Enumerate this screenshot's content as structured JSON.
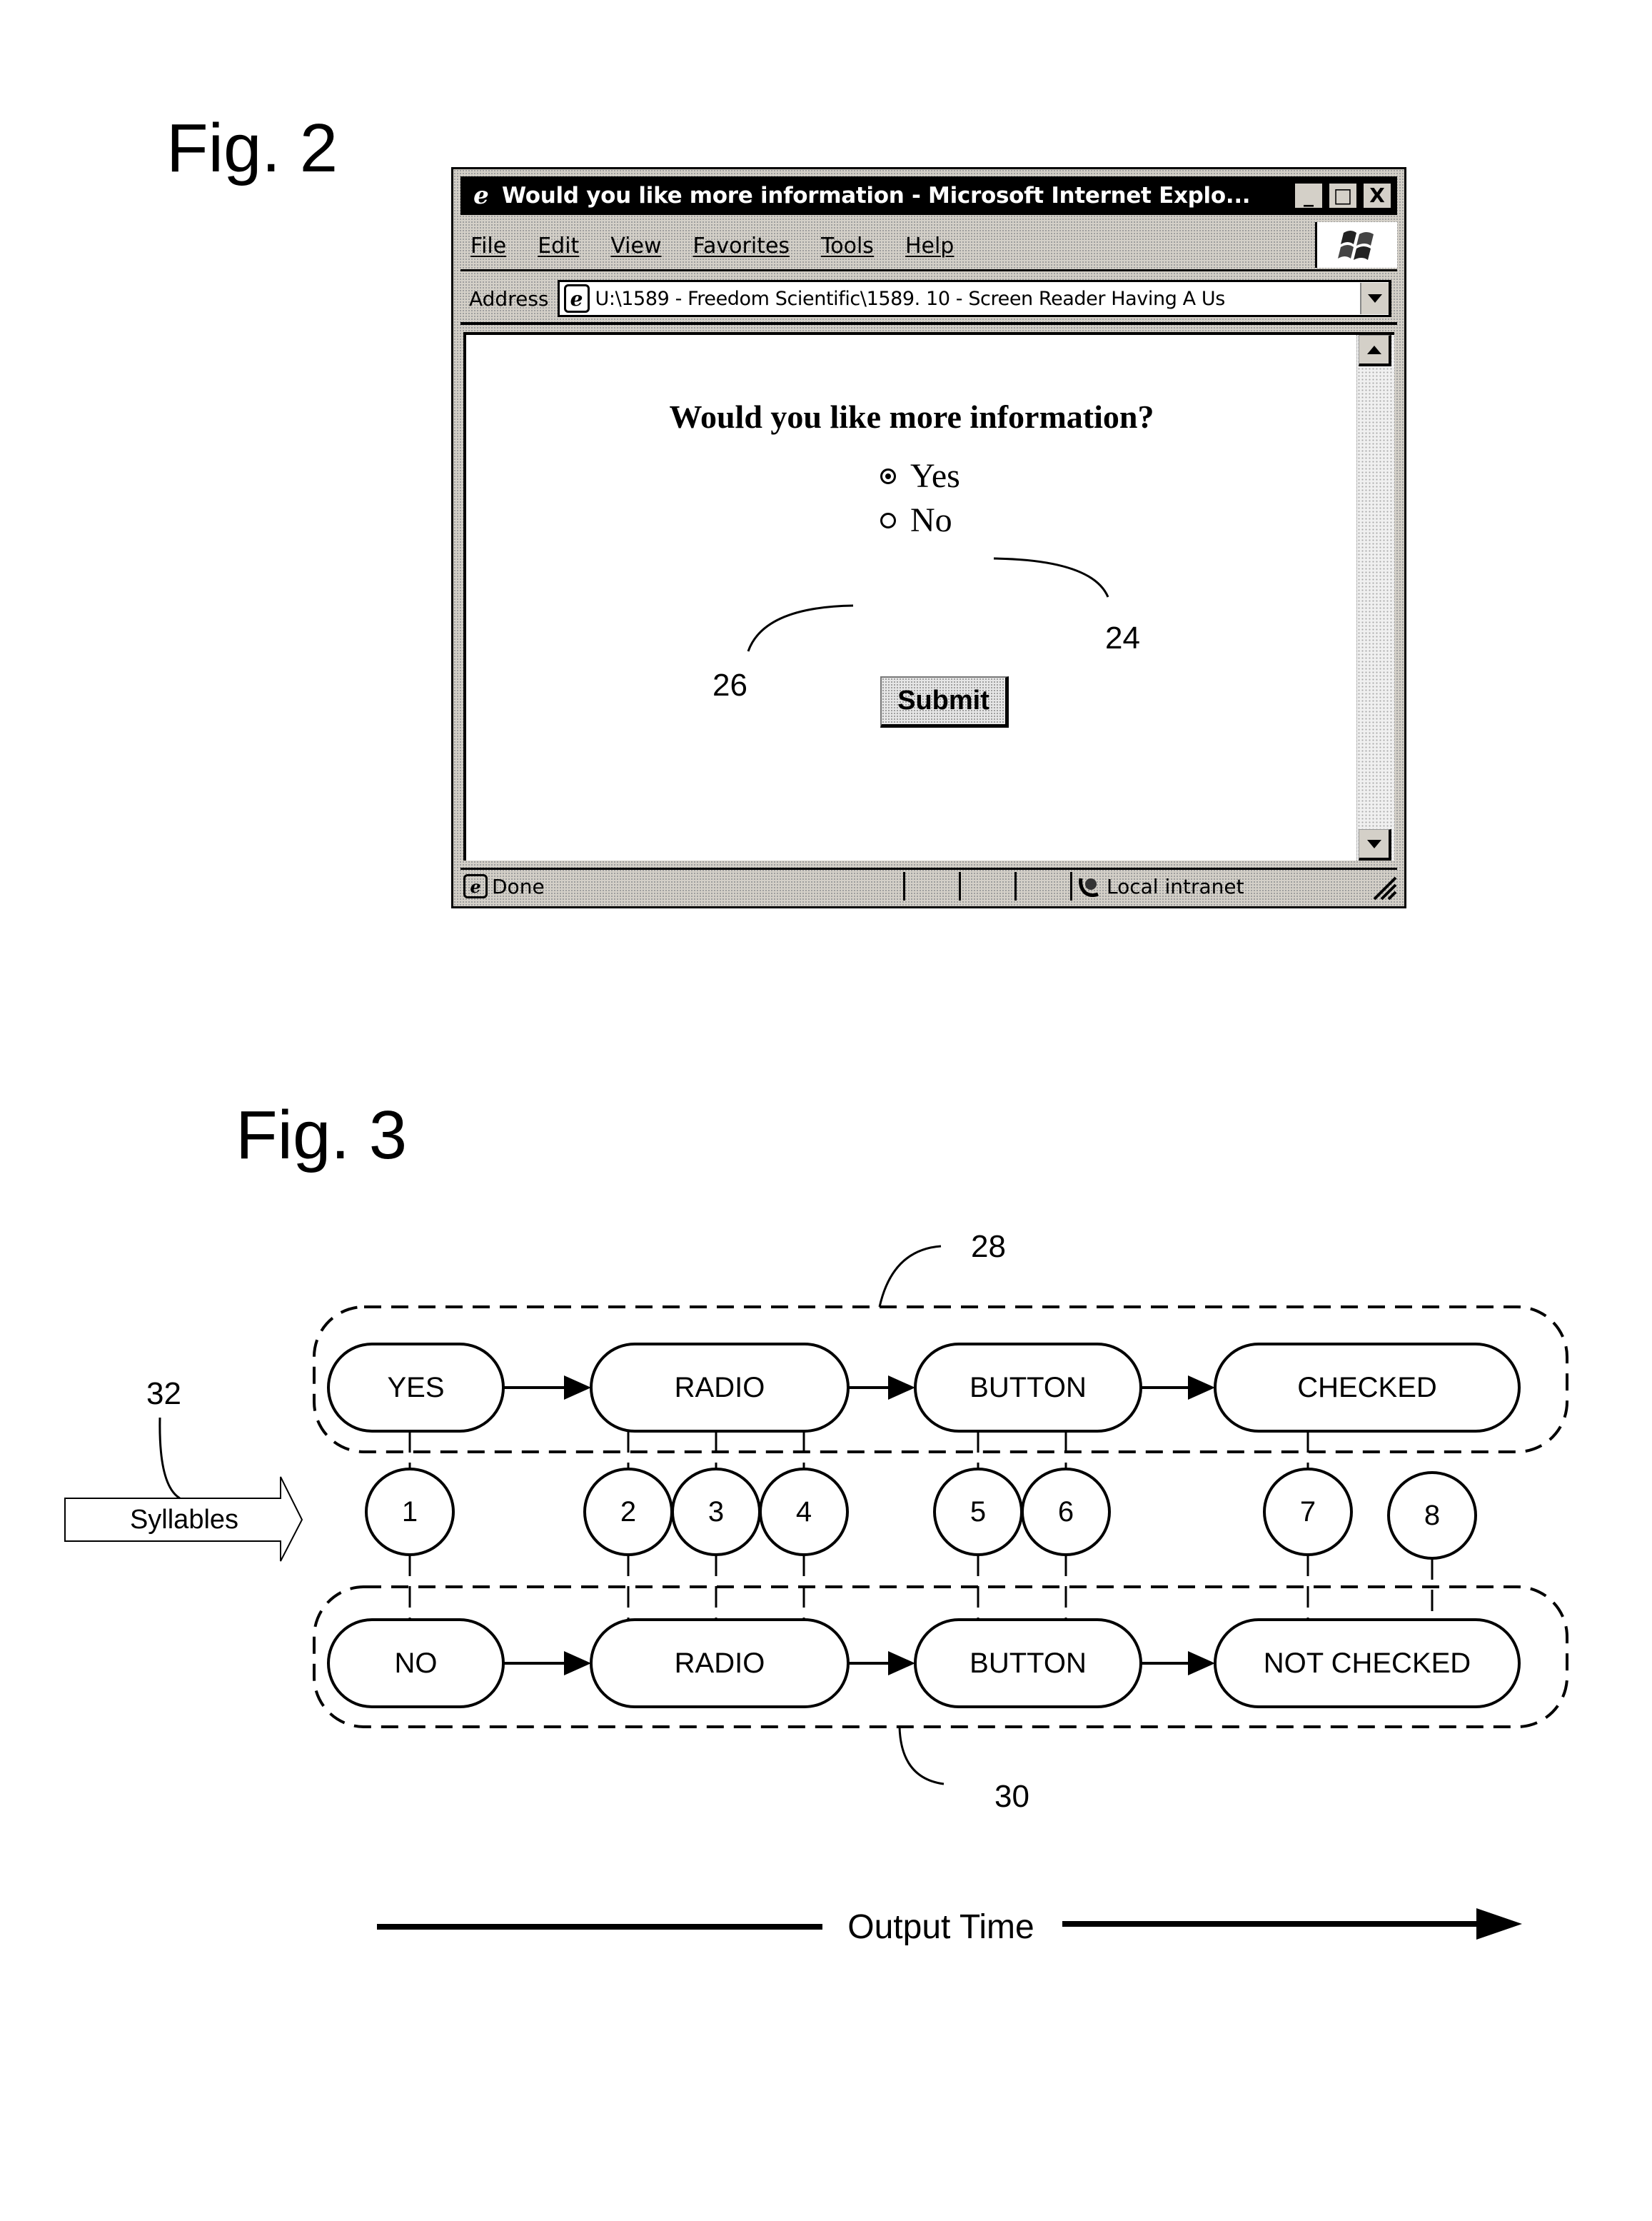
{
  "fig2": {
    "label": "Fig. 2",
    "browser": {
      "title": "Would you like more information - Microsoft Internet Explo...",
      "title_buttons": [
        {
          "name": "minimize-button",
          "glyph": "_"
        },
        {
          "name": "maximize-button",
          "glyph": "□"
        },
        {
          "name": "close-button",
          "glyph": "X"
        }
      ],
      "menu": [
        "File",
        "Edit",
        "View",
        "Favorites",
        "Tools",
        "Help"
      ],
      "address_label": "Address",
      "address_value": "U:\\1589 - Freedom Scientific\\1589. 10 - Screen Reader Having A Us",
      "page": {
        "question": "Would you like more information?",
        "options": [
          {
            "label": "Yes",
            "checked": true
          },
          {
            "label": "No",
            "checked": false
          }
        ],
        "submit_label": "Submit"
      },
      "status_text": "Done",
      "zone_text": "Local intranet"
    },
    "callouts": {
      "yes_ref": "24",
      "no_ref": "26"
    }
  },
  "fig3": {
    "label": "Fig. 3",
    "input_arrow_label": "Syllables",
    "input_ref": "32",
    "top_group_ref": "28",
    "bottom_group_ref": "30",
    "top_sequence": [
      "YES",
      "RADIO",
      "BUTTON",
      "CHECKED"
    ],
    "bottom_sequence": [
      "NO",
      "RADIO",
      "BUTTON",
      "NOT CHECKED"
    ],
    "syllables": [
      {
        "n": "1",
        "top_word": 0,
        "bottom_word": 0
      },
      {
        "n": "2",
        "top_word": 1,
        "bottom_word": 1
      },
      {
        "n": "3",
        "top_word": 1,
        "bottom_word": 1
      },
      {
        "n": "4",
        "top_word": 1,
        "bottom_word": 1
      },
      {
        "n": "5",
        "top_word": 2,
        "bottom_word": 2
      },
      {
        "n": "6",
        "top_word": 2,
        "bottom_word": 2
      },
      {
        "n": "7",
        "top_word": 3,
        "bottom_word": 3
      },
      {
        "n": "8",
        "top_word": null,
        "bottom_word": 3
      }
    ],
    "time_axis_label": "Output Time"
  }
}
